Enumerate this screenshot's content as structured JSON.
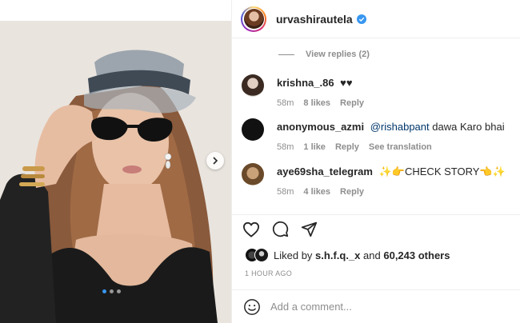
{
  "post": {
    "author": "urvashirautela",
    "verified": true,
    "carousel": {
      "total_dots": 3,
      "active_dot": 1
    }
  },
  "comments_section": {
    "view_replies": "View replies (2)",
    "comments": [
      {
        "username": "krishna_.86",
        "mention": "",
        "text": "♥♥",
        "time": "58m",
        "likes": "8 likes",
        "reply": "Reply",
        "extra": ""
      },
      {
        "username": "anonymous_azmi",
        "mention": "@rishabpant",
        "text": "dawa Karo bhai",
        "time": "58m",
        "likes": "1 like",
        "reply": "Reply",
        "extra": "See translation"
      },
      {
        "username": "aye69sha_telegram",
        "mention": "",
        "text": "✨👉CHECK STORY👈✨",
        "time": "58m",
        "likes": "4 likes",
        "reply": "Reply",
        "extra": ""
      }
    ]
  },
  "actions": {
    "icons": [
      "heart-icon",
      "comment-icon",
      "share-icon"
    ]
  },
  "likes": {
    "prefix": "Liked by",
    "user": "s.h.f.q._x",
    "and": "and",
    "count": "60,243 others"
  },
  "time_ago": "1 HOUR AGO",
  "add_comment": {
    "placeholder": "Add a comment..."
  },
  "colors": {
    "link": "#00376b",
    "verified": "#3897f0",
    "secondary_text": "#8e8e8e"
  }
}
